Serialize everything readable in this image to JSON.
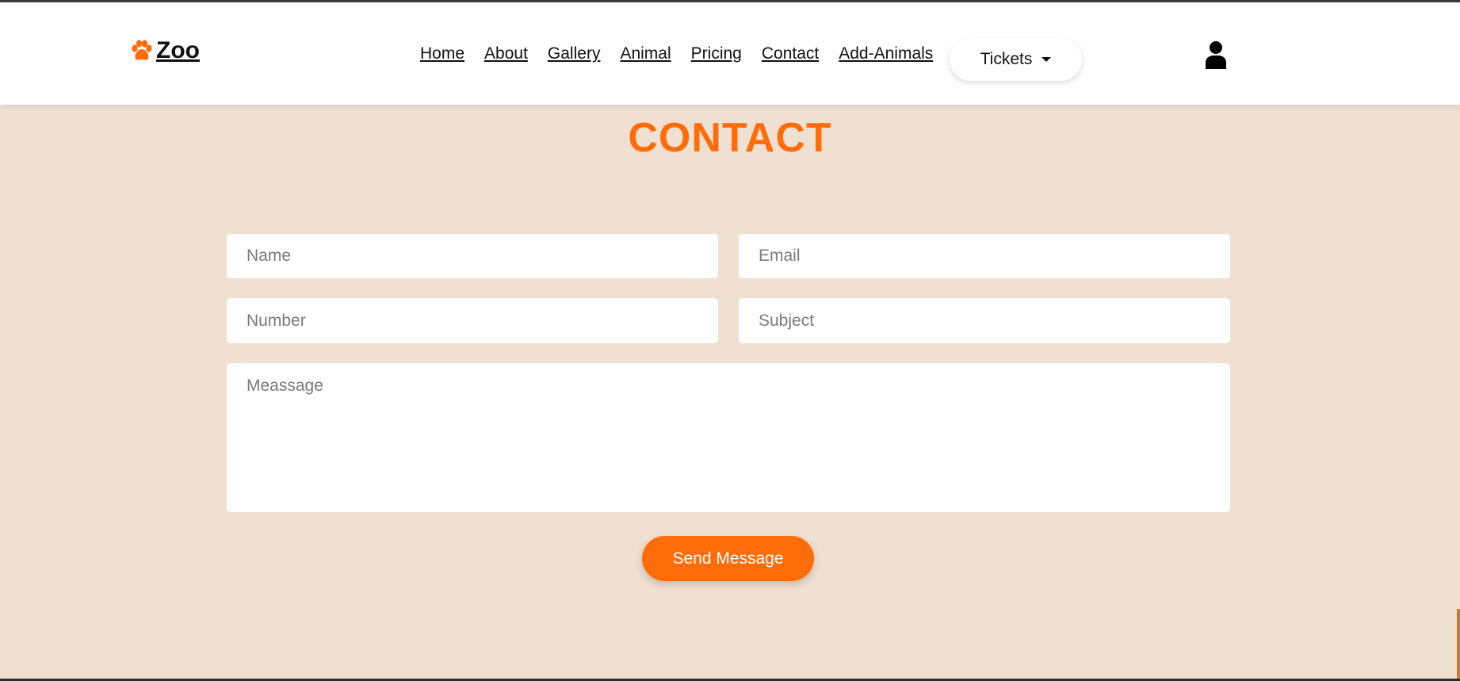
{
  "brand": {
    "name": "Zoo",
    "accent": "#ff6d0a"
  },
  "nav": {
    "links": [
      "Home",
      "About",
      "Gallery",
      "Animal",
      "Pricing",
      "Contact",
      "Add-Animals"
    ],
    "tickets_label": "Tickets"
  },
  "page": {
    "title": "CONTACT"
  },
  "form": {
    "name_placeholder": "Name",
    "email_placeholder": "Email",
    "number_placeholder": "Number",
    "subject_placeholder": "Subject",
    "message_placeholder": "Meassage",
    "submit_label": "Send Message"
  },
  "colors": {
    "background": "#f0e0d2",
    "accent": "#ff6d0a",
    "navbar": "#ffffff"
  },
  "icons": {
    "brand": "paw-icon",
    "tickets": "caret-down-icon",
    "account": "user-icon"
  }
}
